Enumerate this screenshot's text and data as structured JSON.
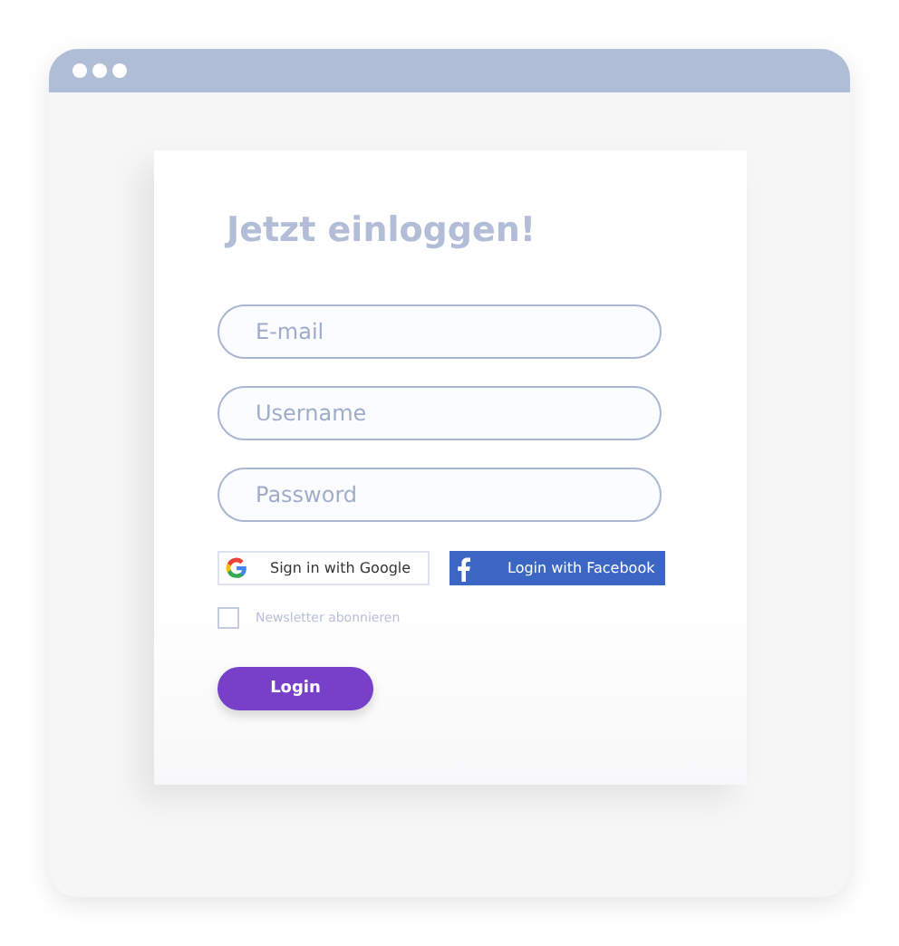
{
  "title": "Jetzt einloggen!",
  "fields": [
    {
      "placeholder": "E-mail"
    },
    {
      "placeholder": "Username"
    },
    {
      "placeholder": "Password"
    }
  ],
  "social": [
    {
      "kind": "google",
      "label": "Sign in with Google"
    },
    {
      "kind": "facebook",
      "label": "Login with Facebook"
    }
  ],
  "newsletter": {
    "label": "Newsletter abonnieren",
    "checked": false
  },
  "login_button": "Login"
}
